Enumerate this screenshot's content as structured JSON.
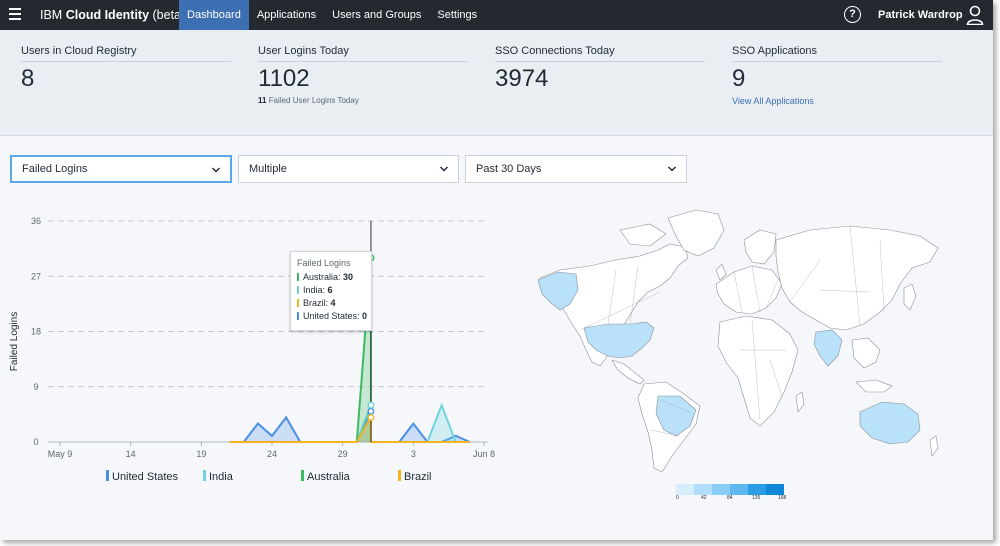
{
  "topbar": {
    "brand_prefix": "IBM ",
    "brand_bold": "Cloud Identity",
    "brand_suffix": " (beta)",
    "nav": [
      "Dashboard",
      "Applications",
      "Users and Groups",
      "Settings"
    ],
    "active_nav": "Dashboard",
    "help_glyph": "?",
    "user_name": "Patrick Wardrop"
  },
  "stats": [
    {
      "label": "Users in Cloud Registry",
      "value": "8"
    },
    {
      "label": "User Logins Today",
      "value": "1102",
      "sub_count": "11",
      "sub_text": "Failed User Logins Today"
    },
    {
      "label": "SSO Connections Today",
      "value": "3974"
    },
    {
      "label": "SSO Applications",
      "value": "9",
      "link": "View All Applications"
    }
  ],
  "filters": {
    "metric": "Failed Logins",
    "countries": "Multiple",
    "range": "Past 30 Days"
  },
  "tooltip": {
    "title": "Failed Logins",
    "rows": [
      {
        "name": "Australia",
        "value": "30",
        "color": "#3dbb61"
      },
      {
        "name": "India",
        "value": "6",
        "color": "#6fd4dc"
      },
      {
        "name": "Brazil",
        "value": "4",
        "color": "#f2b325"
      },
      {
        "name": "United States",
        "value": "0",
        "color": "#4a90e2"
      }
    ]
  },
  "chart_data": {
    "type": "line",
    "ylabel": "Failed Logins",
    "xlabel": "",
    "ylim": [
      0,
      36
    ],
    "yticks": [
      0,
      9,
      18,
      27,
      36
    ],
    "x_tick_labels": [
      "May 9",
      "14",
      "19",
      "24",
      "29",
      "3",
      "Jun 8"
    ],
    "x": [
      "May 21",
      "May 22",
      "May 23",
      "May 24",
      "May 25",
      "May 26",
      "May 27",
      "May 28",
      "May 29",
      "May 30",
      "May 31",
      "Jun 1",
      "Jun 2",
      "Jun 3",
      "Jun 4",
      "Jun 5",
      "Jun 6",
      "Jun 7",
      "Jun 8"
    ],
    "series": [
      {
        "name": "United States",
        "color": "#4a90e2",
        "values": [
          0,
          0,
          3,
          1,
          4,
          0,
          0,
          0,
          0,
          0,
          5,
          0,
          0,
          0,
          3,
          0,
          0,
          1,
          0
        ]
      },
      {
        "name": "India",
        "values": [
          0,
          0,
          0,
          0,
          0,
          0,
          0,
          0,
          0,
          0,
          6,
          0,
          0,
          0,
          0,
          0,
          6,
          0,
          0
        ],
        "color": "#6fd4dc"
      },
      {
        "name": "Australia",
        "color": "#3dbb61",
        "values": [
          0,
          0,
          0,
          0,
          0,
          0,
          0,
          0,
          0,
          0,
          30,
          0,
          0,
          0,
          0,
          0,
          0,
          0,
          0
        ]
      },
      {
        "name": "Brazil",
        "color": "#f2b325",
        "values": [
          0,
          0,
          0,
          0,
          0,
          0,
          0,
          0,
          0,
          0,
          4,
          0,
          0,
          0,
          0,
          0,
          0,
          0,
          0
        ]
      }
    ],
    "highlight_x": "May 31",
    "grid": true
  },
  "map_scale": {
    "labels": [
      "0",
      "42",
      "84",
      "126",
      "168"
    ],
    "colors": [
      "#d6eefb",
      "#b3defa",
      "#8acdf6",
      "#5cb8ef",
      "#2a9de4",
      "#0d87d8"
    ]
  }
}
